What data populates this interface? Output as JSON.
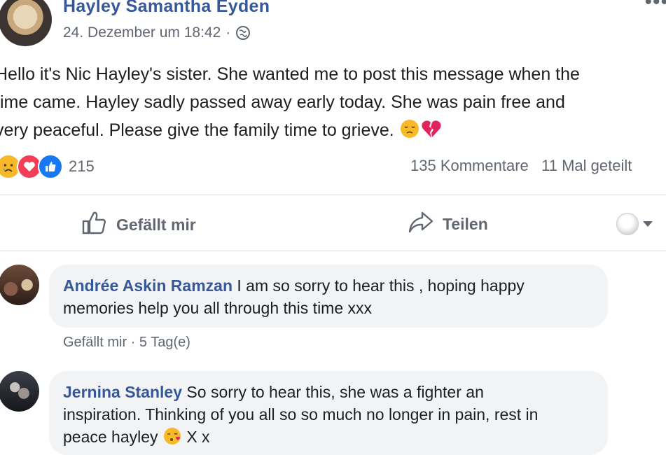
{
  "post": {
    "author": "Hayley Samantha Eyden",
    "timestamp": "24. Dezember um 18:42",
    "privacy_icon": "globe-icon",
    "more_icon": "more-options-icon",
    "text_lines": [
      "Hello it's Nic Hayley's sister. She wanted me to post this message when the",
      "time came. Hayley sadly passed away early today. She was pain free and",
      "very peaceful. Please give the family time to grieve."
    ],
    "text_emojis": [
      "pensive-face-emoji",
      "broken-heart-emoji"
    ]
  },
  "reactions": {
    "icons": [
      "sad-reaction-icon",
      "love-reaction-icon",
      "like-reaction-icon"
    ],
    "count": "215",
    "comments": "135 Kommentare",
    "shares": "11 Mal geteilt"
  },
  "actions": {
    "like_label": "Gefällt mir",
    "share_label": "Teilen"
  },
  "comments": [
    {
      "name": "Andrée Askin Ramzan",
      "text_line1": " I am so sorry to hear this , hoping happy",
      "text_line2": "memories help you all through this time xxx",
      "like_label": "Gefällt mir",
      "separator": " · ",
      "age": "5 Tag(e)"
    },
    {
      "name": "Jernina Stanley",
      "text_line1": " So sorry to hear this, she was a fighter an",
      "text_line2": "inspiration. Thinking of you all so so much no longer in pain, rest in",
      "text_line3a": "peace hayley ",
      "text_line3b": " X x",
      "emoji": "face-blowing-kiss-emoji"
    }
  ],
  "colors": {
    "link_blue": "#365899",
    "meta_gray": "#606770",
    "bubble_bg": "#f2f3f5",
    "like_blue": "#1877f2",
    "love_red": "#f33e58",
    "emoji_yellow": "#f7b928"
  }
}
